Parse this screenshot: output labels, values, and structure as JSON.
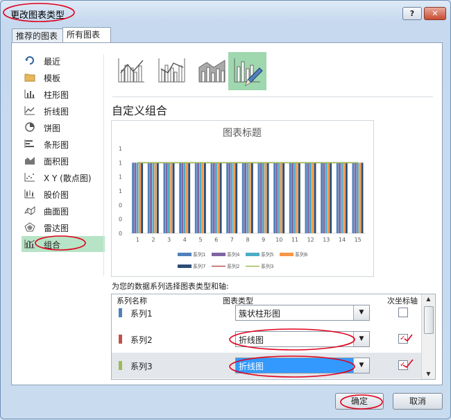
{
  "window": {
    "title": "更改图表类型",
    "help_label": "?",
    "close_label": "✕"
  },
  "tabs": [
    {
      "label": "推荐的图表"
    },
    {
      "label": "所有图表"
    }
  ],
  "categories": [
    {
      "label": "最近",
      "icon": "recent-icon"
    },
    {
      "label": "模板",
      "icon": "folder-icon"
    },
    {
      "label": "柱形图",
      "icon": "column-chart-icon"
    },
    {
      "label": "折线图",
      "icon": "line-chart-icon"
    },
    {
      "label": "饼图",
      "icon": "pie-chart-icon"
    },
    {
      "label": "条形图",
      "icon": "bar-chart-icon"
    },
    {
      "label": "面积图",
      "icon": "area-chart-icon"
    },
    {
      "label": "X Y (散点图)",
      "icon": "scatter-chart-icon"
    },
    {
      "label": "股价图",
      "icon": "stock-chart-icon"
    },
    {
      "label": "曲面图",
      "icon": "surface-chart-icon"
    },
    {
      "label": "雷达图",
      "icon": "radar-chart-icon"
    },
    {
      "label": "组合",
      "icon": "combo-chart-icon"
    }
  ],
  "selected_category": "组合",
  "combo_heading": "自定义组合",
  "series_section_label": "为您的数据系列选择图表类型和轴:",
  "grid": {
    "headers": {
      "name": "系列名称",
      "type": "图表类型",
      "secondary": "次坐标轴"
    },
    "rows": [
      {
        "name": "系列1",
        "type": "簇状柱形图",
        "color": "#4f81bd",
        "secondary": false
      },
      {
        "name": "系列2",
        "type": "折线图",
        "color": "#c0504d",
        "secondary": true
      },
      {
        "name": "系列3",
        "type": "折线图",
        "color": "#9bbb59",
        "secondary": true
      }
    ]
  },
  "buttons": {
    "ok": "确定",
    "cancel": "取消"
  },
  "chart_data": {
    "type": "bar",
    "title": "图表标题",
    "categories": [
      "1",
      "2",
      "3",
      "4",
      "5",
      "6",
      "7",
      "8",
      "9",
      "10",
      "11",
      "12",
      "13",
      "14",
      "15"
    ],
    "y_tick_labels": [
      "0",
      "0",
      "0",
      "1",
      "1",
      "1",
      "1"
    ],
    "bar_series": [
      {
        "name": "系列1",
        "color": "#4f81bd",
        "values": [
          1,
          1,
          1,
          1,
          1,
          1,
          1,
          1,
          1,
          1,
          1,
          1,
          1,
          1,
          1
        ]
      },
      {
        "name": "系列4",
        "color": "#8064a2",
        "values": [
          1,
          1,
          1,
          1,
          1,
          1,
          1,
          1,
          1,
          1,
          1,
          1,
          1,
          1,
          1
        ]
      },
      {
        "name": "系列5",
        "color": "#4bacc6",
        "values": [
          1,
          1,
          1,
          1,
          1,
          1,
          1,
          1,
          1,
          1,
          1,
          1,
          1,
          1,
          1
        ]
      },
      {
        "name": "系列6",
        "color": "#f79646",
        "values": [
          1,
          1,
          1,
          1,
          1,
          1,
          1,
          1,
          1,
          1,
          1,
          1,
          1,
          1,
          1
        ]
      },
      {
        "name": "系列7",
        "color": "#2c4d75",
        "values": [
          1,
          1,
          1,
          1,
          1,
          1,
          1,
          1,
          1,
          1,
          1,
          1,
          1,
          1,
          1
        ]
      }
    ],
    "line_series": [
      {
        "name": "系列2",
        "color": "#c0504d",
        "values": [
          1,
          1,
          1,
          1,
          1,
          1,
          1,
          1,
          1,
          1,
          1,
          1,
          1,
          1,
          1
        ]
      },
      {
        "name": "系列3",
        "color": "#9bbb59",
        "values": [
          1,
          1,
          1,
          1,
          1,
          1,
          1,
          1,
          1,
          1,
          1,
          1,
          1,
          1,
          1
        ]
      }
    ],
    "legend": [
      "系列1",
      "系列4",
      "系列5",
      "系列6",
      "系列7",
      "系列2",
      "系列3"
    ],
    "ylim": [
      0,
      1.2
    ],
    "grid": false
  }
}
